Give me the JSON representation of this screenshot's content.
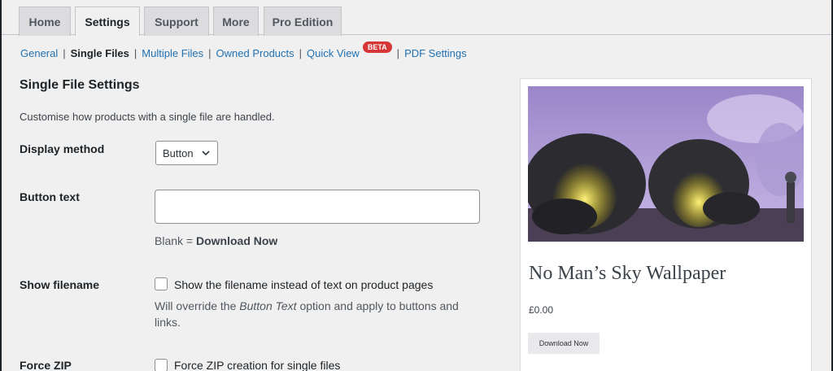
{
  "tabs": [
    {
      "label": "Home"
    },
    {
      "label": "Settings",
      "active": true
    },
    {
      "label": "Support"
    },
    {
      "label": "More"
    },
    {
      "label": "Pro Edition"
    }
  ],
  "subnav": {
    "items": [
      "General",
      "Single Files",
      "Multiple Files",
      "Owned Products",
      "Quick View",
      "PDF Settings"
    ],
    "badge": "BETA",
    "separator": "|"
  },
  "section": {
    "title": "Single File Settings",
    "description": "Customise how products with a single file are handled."
  },
  "fields": {
    "display_method": {
      "label": "Display method",
      "value": "Button"
    },
    "button_text": {
      "label": "Button text",
      "value": "",
      "hint_prefix": "Blank = ",
      "hint_bold": "Download Now"
    },
    "show_filename": {
      "label": "Show filename",
      "checked": false,
      "checkbox_label": "Show the filename instead of text on product pages",
      "hint_prefix": "Will override the ",
      "hint_italic": "Button Text",
      "hint_suffix": " option and apply to buttons and links."
    },
    "force_zip": {
      "label": "Force ZIP",
      "checked": false,
      "checkbox_label": "Force ZIP creation for single files"
    }
  },
  "preview": {
    "title": "No Man’s Sky Wallpaper",
    "price": "£0.00",
    "button_label": "Download Now"
  },
  "colors": {
    "link": "#2271b1",
    "badge": "#d63638",
    "background": "#f0f0f1"
  }
}
